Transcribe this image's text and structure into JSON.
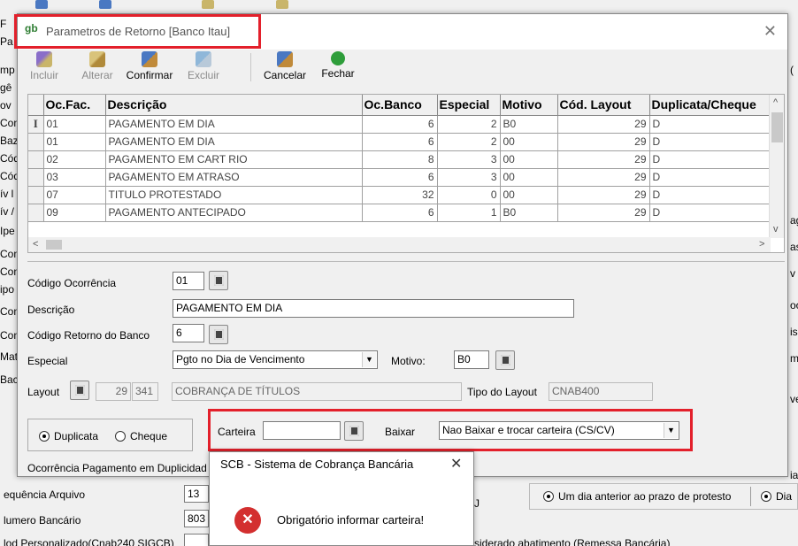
{
  "background": {
    "left_labels": [
      "F",
      "Pa",
      "mp",
      "gê",
      "ov",
      "Con",
      "Baz",
      "Cód",
      "Cód",
      "ív l",
      "ív /",
      "Ipe",
      "Con",
      "Con",
      "ipo",
      "Con",
      "Con",
      "Mat",
      "Bac"
    ],
    "right_labels": [
      "(",
      "ag",
      "as",
      "v",
      "oo",
      "is",
      "m",
      "ve",
      "ia"
    ],
    "sequencia_label": "equência Arquivo",
    "sequencia_value": "13",
    "numero_label": "lumero Bancário",
    "numero_value": "803",
    "personalizado_label": "lod Personalizado(Cnab240 SIGCB)",
    "desconsiderado_text": "siderado abatimento (Remessa Bancária)",
    "j_text": "J",
    "radio_protesto": "Um dia anterior ao prazo de protesto",
    "radio_dia": "Dia"
  },
  "window": {
    "title": "Parametros de Retorno [Banco Itau]",
    "logo_text": "gb"
  },
  "toolbar": {
    "incluir": "Incluir",
    "alterar": "Alterar",
    "confirmar": "Confirmar",
    "excluir": "Excluir",
    "cancelar": "Cancelar",
    "fechar": "Fechar"
  },
  "grid": {
    "headers": [
      "Oc.Fac.",
      "Descrição",
      "Oc.Banco",
      "Especial",
      "Motivo",
      "Cód. Layout",
      "Duplicata/Cheque"
    ],
    "current_marker": "I",
    "rows": [
      [
        "01",
        "PAGAMENTO EM DIA",
        "6",
        "2",
        "B0",
        "29",
        "D"
      ],
      [
        "01",
        "PAGAMENTO EM DIA",
        "6",
        "2",
        "00",
        "29",
        "D"
      ],
      [
        "02",
        "PAGAMENTO EM CART RIO",
        "8",
        "3",
        "00",
        "29",
        "D"
      ],
      [
        "03",
        "PAGAMENTO EM ATRASO",
        "6",
        "3",
        "00",
        "29",
        "D"
      ],
      [
        "07",
        "TITULO PROTESTADO",
        "32",
        "0",
        "00",
        "29",
        "D"
      ],
      [
        "09",
        "PAGAMENTO ANTECIPADO",
        "6",
        "1",
        "B0",
        "29",
        "D"
      ]
    ]
  },
  "form": {
    "codigo_ocorrencia_label": "Código Ocorrência",
    "codigo_ocorrencia_value": "01",
    "descricao_label": "Descrição",
    "descricao_value": "PAGAMENTO EM DIA",
    "codigo_retorno_label": "Código Retorno do Banco",
    "codigo_retorno_value": "6",
    "especial_label": "Especial",
    "especial_value": "Pgto no Dia de Vencimento",
    "motivo_label": "Motivo:",
    "motivo_value": "B0",
    "layout_label": "Layout",
    "layout_num": "29",
    "layout_code": "341",
    "layout_desc": "COBRANÇA DE TÍTULOS",
    "tipo_layout_label": "Tipo do Layout",
    "tipo_layout_value": "CNAB400",
    "duplicata_label": "Duplicata",
    "cheque_label": "Cheque",
    "carteira_label": "Carteira",
    "carteira_value": "",
    "baixar_label": "Baixar",
    "baixar_value": "Nao Baixar e trocar carteira (CS/CV)",
    "ocorrencia_pag_label": "Ocorrência Pagamento em Duplicidad"
  },
  "dialog": {
    "title": "SCB - Sistema de Cobrança Bancária",
    "message": "Obrigatório informar carteira!",
    "icon_glyph": "✕"
  },
  "colors": {
    "highlight_red": "#e3202b",
    "error_red": "#d32f2f"
  }
}
